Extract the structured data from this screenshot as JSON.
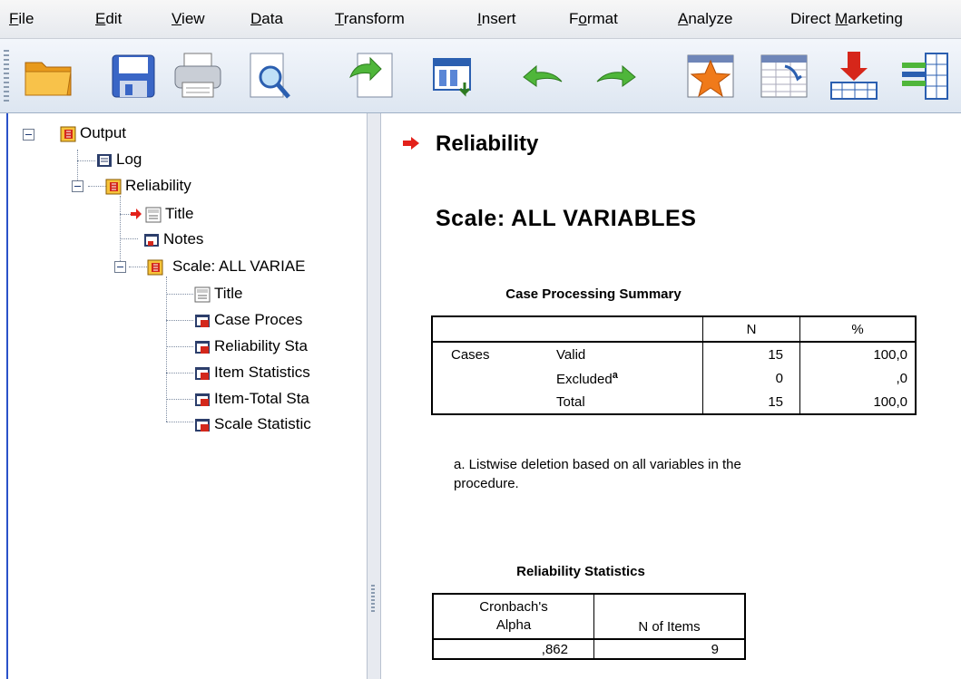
{
  "menu": [
    {
      "label": "File",
      "u": "F",
      "rest": "ile"
    },
    {
      "label": "Edit",
      "u": "E",
      "rest": "dit"
    },
    {
      "label": "View",
      "u": "V",
      "rest": "iew"
    },
    {
      "label": "Data",
      "u": "D",
      "rest": "ata"
    },
    {
      "label": "Transform",
      "u": "T",
      "rest": "ransform"
    },
    {
      "label": "Insert",
      "u": "I",
      "rest": "nsert"
    },
    {
      "label": "Format",
      "pre": "F",
      "u": "o",
      "rest": "rmat"
    },
    {
      "label": "Analyze",
      "u": "A",
      "rest": "nalyze"
    },
    {
      "label": "Direct Marketing",
      "pre": "Direct ",
      "u": "M",
      "rest": "arketing"
    }
  ],
  "toolbar": [
    "open-folder-icon",
    "save-icon",
    "print-icon",
    "print-preview-icon",
    "export-icon",
    "recall-dialog-icon",
    "undo-icon",
    "redo-icon",
    "goto-case-icon",
    "goto-variable-icon",
    "insert-cases-icon",
    "insert-variable-icon"
  ],
  "tree": {
    "root": "Output",
    "log": "Log",
    "reliability": "Reliability",
    "title1": "Title",
    "notes": "Notes",
    "scale": "Scale: ALL VARIAE",
    "title2": "Title",
    "case": "Case Proces",
    "relstat": "Reliability Sta",
    "itemstat": "Item Statistics",
    "itemtotal": "Item-Total Sta",
    "scalestat": "Scale Statistic"
  },
  "content": {
    "heading": "Reliability",
    "scale_heading": "Scale: ALL VARIABLES",
    "case_table": {
      "title": "Case Processing Summary",
      "col_n": "N",
      "col_pct": "%",
      "group": "Cases",
      "rows": [
        {
          "label": "Valid",
          "n": "15",
          "pct": "100,0"
        },
        {
          "label": "Excluded",
          "sup": "a",
          "n": "0",
          "pct": ",0"
        },
        {
          "label": "Total",
          "n": "15",
          "pct": "100,0"
        }
      ],
      "footnote": "a. Listwise deletion based on all variables in the procedure."
    },
    "rel_table": {
      "title": "Reliability Statistics",
      "col1a": "Cronbach's",
      "col1b": "Alpha",
      "col2": "N of Items",
      "alpha": ",862",
      "items": "9"
    }
  }
}
